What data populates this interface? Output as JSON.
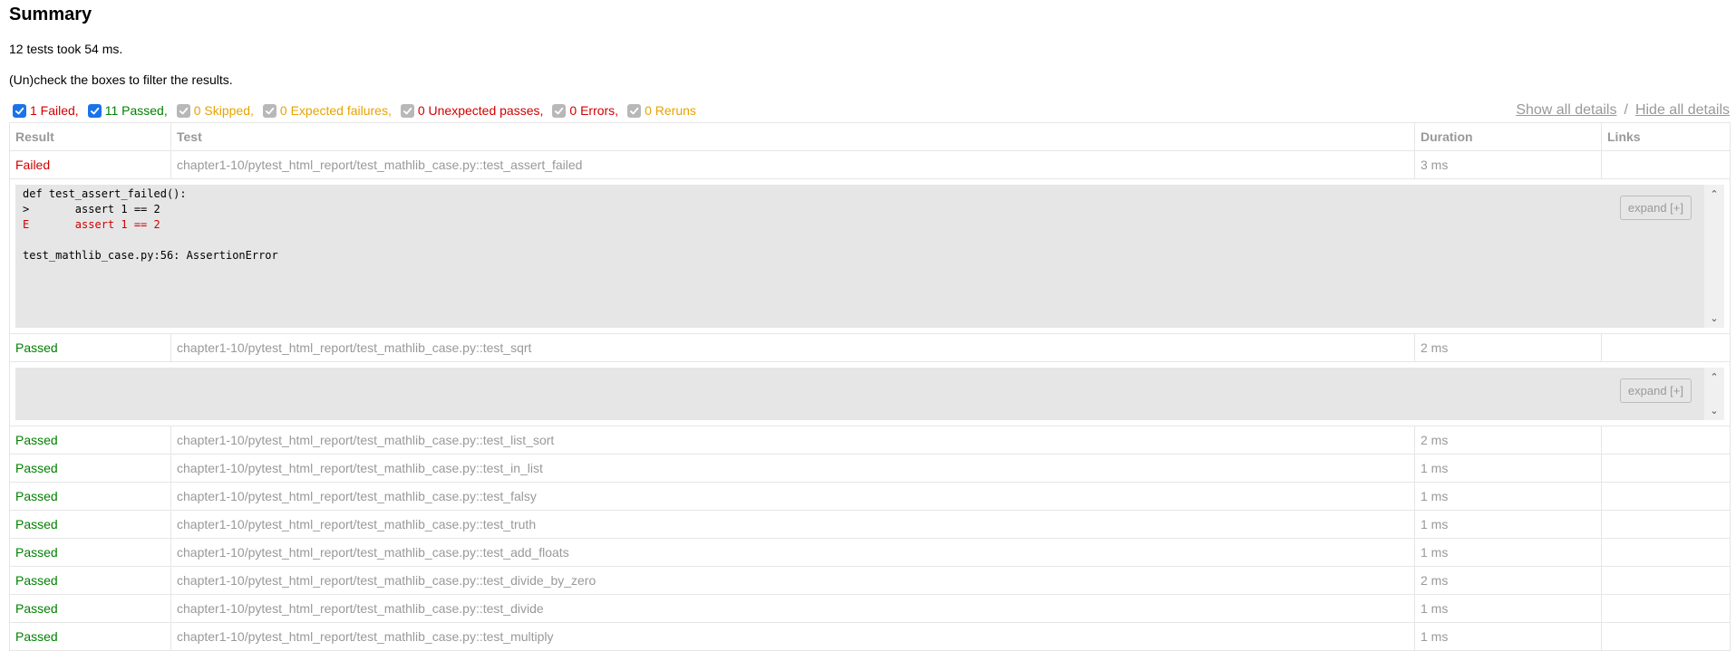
{
  "summary": {
    "title": "Summary",
    "tests_line": "12 tests took 54 ms.",
    "filter_hint": "(Un)check the boxes to filter the results."
  },
  "filters": [
    {
      "label": "1 Failed,",
      "checked": true,
      "color": "#d00000"
    },
    {
      "label": "11 Passed,",
      "checked": true,
      "color": "#008000"
    },
    {
      "label": "0 Skipped,",
      "checked": false,
      "color": "#e8a300"
    },
    {
      "label": "0 Expected failures,",
      "checked": false,
      "color": "#e8a300"
    },
    {
      "label": "0 Unexpected passes,",
      "checked": false,
      "color": "#d00000"
    },
    {
      "label": "0 Errors,",
      "checked": false,
      "color": "#d00000"
    },
    {
      "label": "0 Reruns",
      "checked": false,
      "color": "#e8a300"
    }
  ],
  "details_links": {
    "show": "Show all details",
    "separator": "/",
    "hide": "Hide all details"
  },
  "table": {
    "headers": [
      "Result",
      "Test",
      "Duration",
      "Links"
    ],
    "rows": [
      {
        "result": "Failed",
        "test": "chapter1-10/pytest_html_report/test_mathlib_case.py::test_assert_failed",
        "duration": "3 ms"
      },
      {
        "result": "Passed",
        "test": "chapter1-10/pytest_html_report/test_mathlib_case.py::test_sqrt",
        "duration": "2 ms"
      },
      {
        "result": "Passed",
        "test": "chapter1-10/pytest_html_report/test_mathlib_case.py::test_list_sort",
        "duration": "2 ms"
      },
      {
        "result": "Passed",
        "test": "chapter1-10/pytest_html_report/test_mathlib_case.py::test_in_list",
        "duration": "1 ms"
      },
      {
        "result": "Passed",
        "test": "chapter1-10/pytest_html_report/test_mathlib_case.py::test_falsy",
        "duration": "1 ms"
      },
      {
        "result": "Passed",
        "test": "chapter1-10/pytest_html_report/test_mathlib_case.py::test_truth",
        "duration": "1 ms"
      },
      {
        "result": "Passed",
        "test": "chapter1-10/pytest_html_report/test_mathlib_case.py::test_add_floats",
        "duration": "1 ms"
      },
      {
        "result": "Passed",
        "test": "chapter1-10/pytest_html_report/test_mathlib_case.py::test_divide_by_zero",
        "duration": "2 ms"
      },
      {
        "result": "Passed",
        "test": "chapter1-10/pytest_html_report/test_mathlib_case.py::test_divide",
        "duration": "1 ms"
      },
      {
        "result": "Passed",
        "test": "chapter1-10/pytest_html_report/test_mathlib_case.py::test_multiply",
        "duration": "1 ms"
      }
    ]
  },
  "failed_log": {
    "lines": [
      {
        "text": "def test_assert_failed():",
        "error": false
      },
      {
        "text": ">       assert 1 == 2",
        "error": false
      },
      {
        "text": "E       assert 1 == 2",
        "error": true
      },
      {
        "text": "",
        "error": false
      },
      {
        "text": "test_mathlib_case.py:56: AssertionError",
        "error": false
      }
    ]
  },
  "expand_label": "expand [+]",
  "scroll_up_glyph": "⌃",
  "scroll_down_glyph": "⌄"
}
